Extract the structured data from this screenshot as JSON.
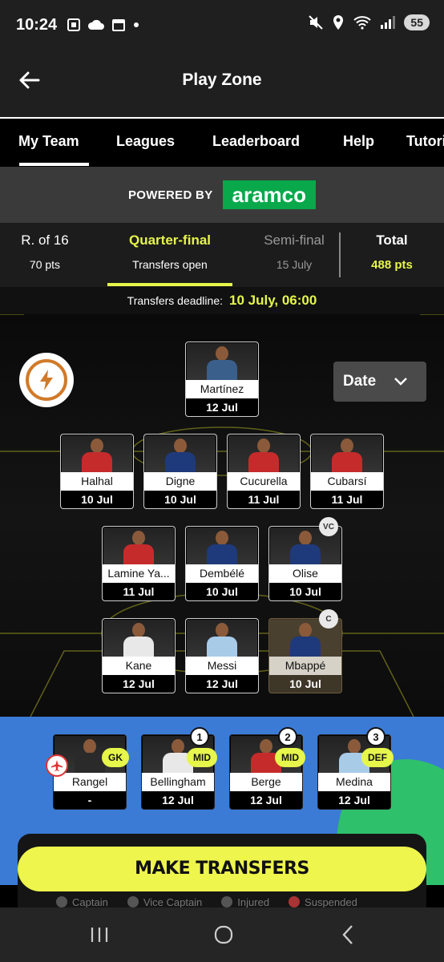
{
  "status_bar": {
    "time": "10:24",
    "left_icons": [
      "screenshot-icon",
      "cloud-icon",
      "calendar-icon",
      "dot-icon"
    ],
    "right_icons": [
      "mute-icon",
      "location-icon",
      "wifi-icon",
      "signal-icon"
    ],
    "battery": "55"
  },
  "app_bar": {
    "title": "Play Zone"
  },
  "tabs": [
    {
      "label": "My Team",
      "active": true
    },
    {
      "label": "Leagues"
    },
    {
      "label": "Leaderboard"
    },
    {
      "label": "Help"
    },
    {
      "label": "Tutorial"
    }
  ],
  "sponsor": {
    "powered_by": "POWERED BY",
    "brand": "aramco"
  },
  "rounds": [
    {
      "title": "R. of 16",
      "sub": "70 pts"
    },
    {
      "title": "Quarter-final",
      "sub": "Transfers open",
      "active": true
    },
    {
      "title": "Semi-final",
      "sub": "15 July"
    }
  ],
  "total": {
    "title": "Total",
    "value": "488 pts"
  },
  "deadline": {
    "label": "Transfers deadline:",
    "value": "10 July, 06:00"
  },
  "date_sort": {
    "label": "Date"
  },
  "goalkeeper": {
    "name": "Martínez",
    "date": "12 Jul",
    "kit": "#3a5f8a"
  },
  "defenders": [
    {
      "name": "Halhal",
      "date": "10 Jul",
      "kit": "#c62b2b"
    },
    {
      "name": "Digne",
      "date": "10 Jul",
      "kit": "#1e3a7a"
    },
    {
      "name": "Cucurella",
      "date": "11 Jul",
      "kit": "#c62b2b"
    },
    {
      "name": "Cubarsí",
      "date": "11 Jul",
      "kit": "#c62b2b"
    }
  ],
  "midfielders": [
    {
      "name": "Lamine Ya...",
      "date": "11 Jul",
      "kit": "#c62b2b"
    },
    {
      "name": "Dembélé",
      "date": "10 Jul",
      "kit": "#1e3a7a"
    },
    {
      "name": "Olise",
      "date": "10 Jul",
      "kit": "#1e3a7a",
      "badge": "VC"
    }
  ],
  "forwards": [
    {
      "name": "Kane",
      "date": "12 Jul",
      "kit": "#e8e8e8"
    },
    {
      "name": "Messi",
      "date": "12 Jul",
      "kit": "#a8cbe8"
    },
    {
      "name": "Mbappé",
      "date": "10 Jul",
      "kit": "#1e3a7a",
      "badge": "C",
      "captain": true
    }
  ],
  "bench": [
    {
      "name": "Rangel",
      "date": "-",
      "pos": "GK",
      "kit": "#2a2a2a"
    },
    {
      "name": "Bellingham",
      "date": "12 Jul",
      "pos": "MID",
      "num": "1",
      "kit": "#e8e8e8"
    },
    {
      "name": "Berge",
      "date": "12 Jul",
      "pos": "MID",
      "num": "2",
      "kit": "#c62b2b"
    },
    {
      "name": "Medina",
      "date": "12 Jul",
      "pos": "DEF",
      "num": "3",
      "kit": "#a8cbe8"
    }
  ],
  "cta": {
    "label": "MAKE TRANSFERS"
  },
  "legend": [
    {
      "icon": "C",
      "label": "Captain"
    },
    {
      "icon": "VC",
      "label": "Vice Captain"
    },
    {
      "icon": "+",
      "label": "Injured"
    },
    {
      "icon": "■",
      "label": "Suspended"
    }
  ],
  "colors": {
    "accent": "#e6f64a",
    "bench_blue": "#3b7bd6",
    "bench_green": "#2ec06a",
    "sponsor_green": "#08a84b"
  }
}
